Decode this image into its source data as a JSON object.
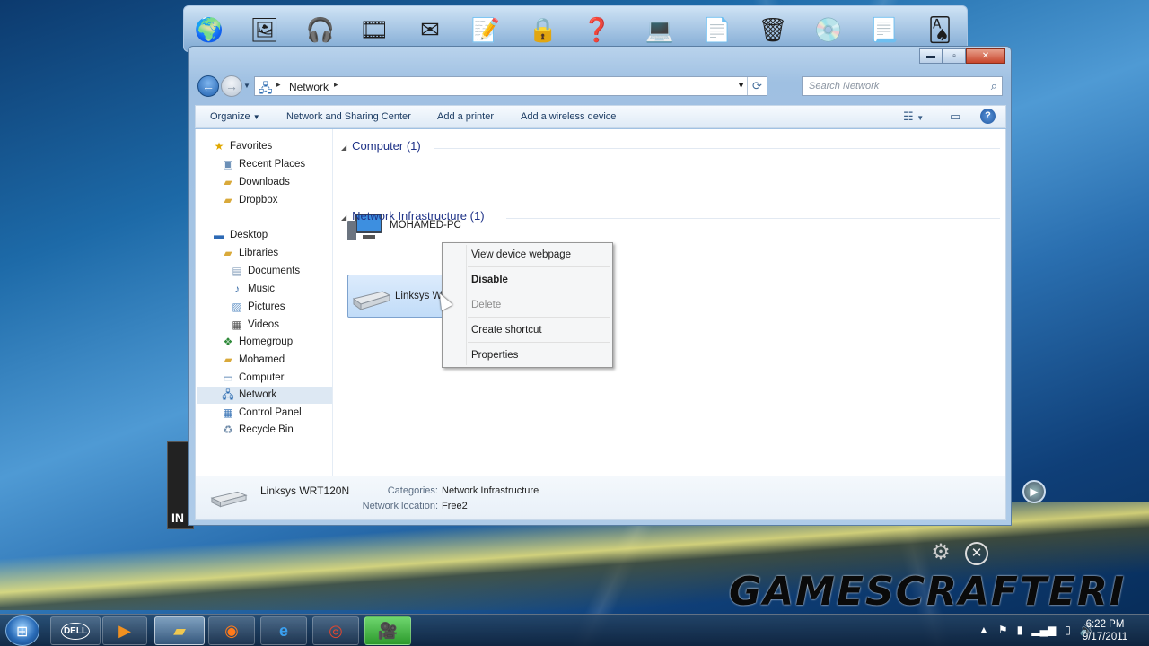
{
  "window": {
    "controls": {
      "minimize": "▬",
      "maximize": "▫",
      "close": "✕"
    }
  },
  "navbar": {
    "breadcrumb": "Network",
    "search_placeholder": "Search Network"
  },
  "toolbar": {
    "organize": "Organize",
    "network_sharing": "Network and Sharing Center",
    "add_printer": "Add a printer",
    "add_wireless": "Add a wireless device"
  },
  "navpane": {
    "favorites": {
      "label": "Favorites",
      "items": [
        "Recent Places",
        "Downloads",
        "Dropbox"
      ]
    },
    "desktop": "Desktop",
    "libraries": {
      "label": "Libraries",
      "items": [
        "Documents",
        "Music",
        "Pictures",
        "Videos"
      ]
    },
    "others": [
      "Homegroup",
      "Mohamed",
      "Computer",
      "Network",
      "Control Panel",
      "Recycle Bin"
    ],
    "selected": "Network"
  },
  "content": {
    "groups": [
      {
        "title": "Computer (1)",
        "items": [
          "MOHAMED-PC"
        ]
      },
      {
        "title": "Network Infrastructure (1)",
        "items": [
          "Linksys WRT120N"
        ]
      }
    ],
    "router_label_visible": "Linksys WR"
  },
  "context_menu": {
    "items": [
      {
        "label": "View device webpage",
        "style": "normal"
      },
      {
        "label": "Disable",
        "style": "bold"
      },
      {
        "label": "Delete",
        "style": "disabled"
      },
      {
        "label": "Create shortcut",
        "style": "normal"
      },
      {
        "label": "Properties",
        "style": "normal"
      }
    ]
  },
  "details": {
    "name": "Linksys WRT120N",
    "categories_label": "Categories:",
    "categories_value": "Network Infrastructure",
    "location_label": "Network location:",
    "location_value": "Free2"
  },
  "desktop": {
    "watermark": "GAMESCRAFTERI",
    "gadget_text": "IN"
  },
  "taskbar": {
    "time": "6:22 PM",
    "date": "9/17/2011"
  },
  "colors": {
    "group_heading": "#1e3287",
    "selection": "#c1dcf8",
    "accent": "#1f56a0"
  }
}
